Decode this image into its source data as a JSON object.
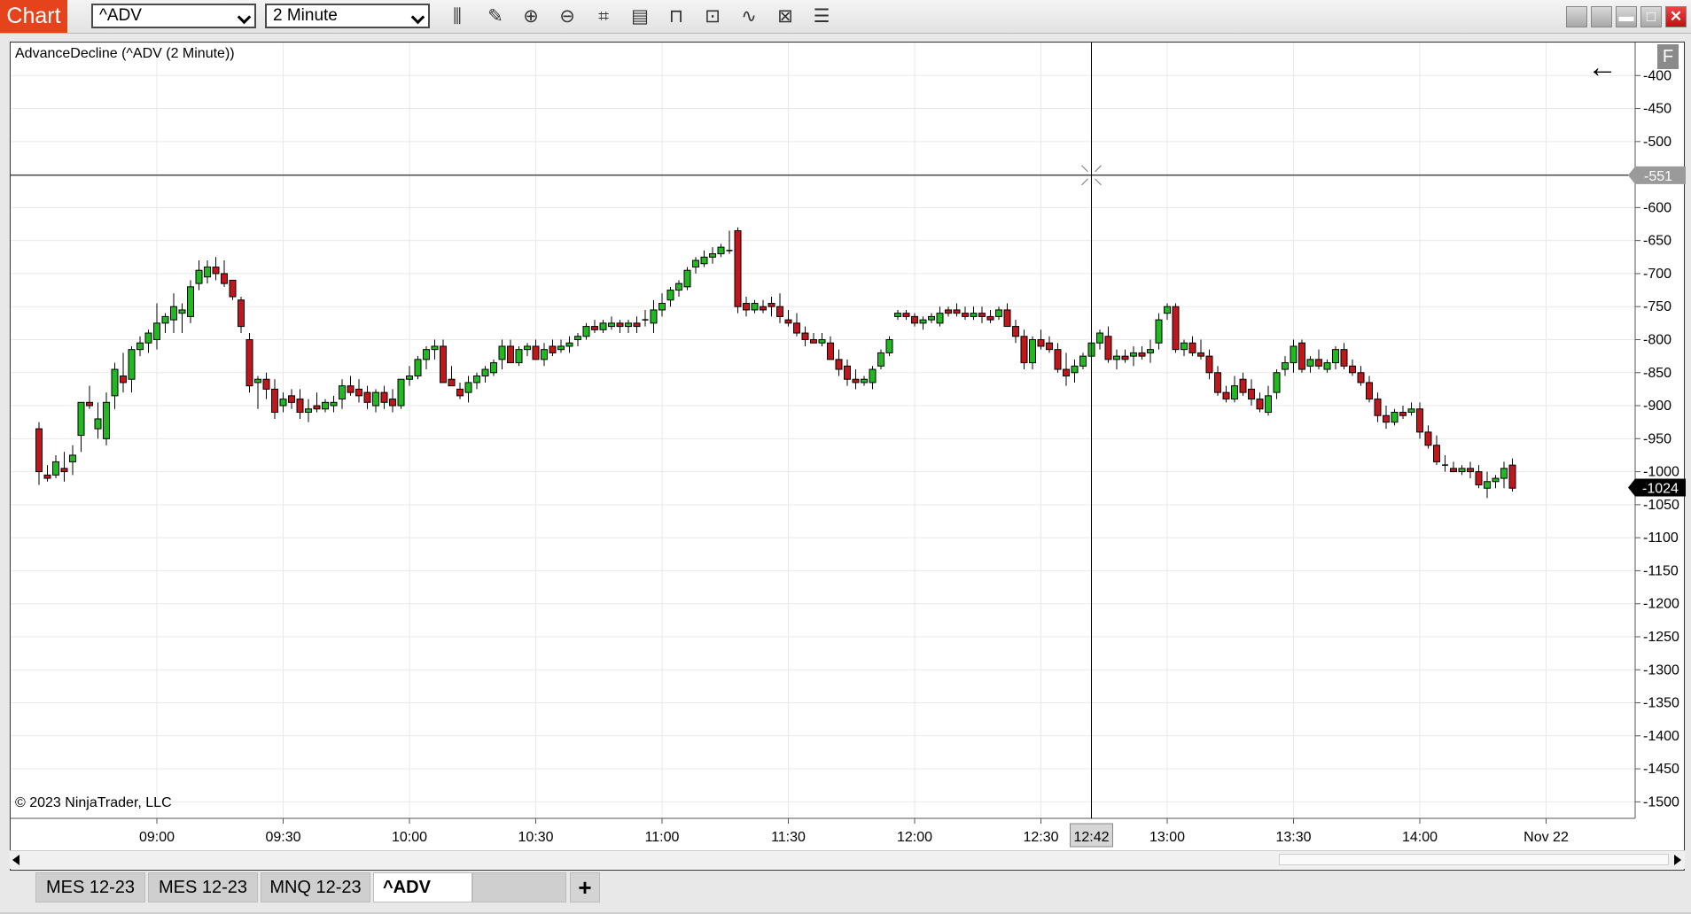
{
  "toolbar": {
    "chart_tab": "Chart",
    "instrument": "^ADV",
    "interval": "2 Minute",
    "tools": [
      {
        "name": "bars-type-icon",
        "glyph": "⫼"
      },
      {
        "name": "drawing-tool-icon",
        "glyph": "✎"
      },
      {
        "name": "zoom-in-icon",
        "glyph": "⊕"
      },
      {
        "name": "zoom-out-icon",
        "glyph": "⊖"
      },
      {
        "name": "crosshair-icon",
        "glyph": "⌗"
      },
      {
        "name": "data-box-icon",
        "glyph": "▤"
      },
      {
        "name": "strategies-icon",
        "glyph": "⊓"
      },
      {
        "name": "properties-icon",
        "glyph": "⊡"
      },
      {
        "name": "indicators-icon",
        "glyph": "∿"
      },
      {
        "name": "chart-trader-icon",
        "glyph": "⊠"
      },
      {
        "name": "show-list-icon",
        "glyph": "☰"
      }
    ],
    "window_buttons": [
      {
        "name": "window-option-button",
        "glyph": ""
      },
      {
        "name": "window-option-button-2",
        "glyph": ""
      },
      {
        "name": "minimize-button",
        "glyph": "▬"
      },
      {
        "name": "maximize-button",
        "glyph": "□"
      },
      {
        "name": "close-button",
        "glyph": "✕"
      }
    ]
  },
  "chart": {
    "indicator_label": "AdvanceDecline (^ADV (2 Minute))",
    "copyright": "© 2023 NinjaTrader, LLC",
    "back_icon": "←",
    "f_button": "F",
    "crosshair_price_label": "-551",
    "crosshair_time_label": "12:42",
    "last_price_label": "-1024",
    "colors": {
      "up": "#22b822",
      "down": "#c0161c",
      "grid": "#e9e9e9",
      "crosshair": "#000000"
    }
  },
  "chart_data": {
    "type": "candlestick",
    "x_ticks": [
      "09:00",
      "09:30",
      "10:00",
      "10:30",
      "11:00",
      "11:30",
      "12:00",
      "12:30",
      "13:00",
      "13:30",
      "14:00",
      "Nov 22"
    ],
    "y_ticks": [
      -400,
      -450,
      -500,
      -600,
      -650,
      -700,
      -750,
      -800,
      -850,
      -900,
      -950,
      -1000,
      -1050,
      -1100,
      -1150,
      -1200,
      -1250,
      -1300,
      -1350,
      -1400,
      -1450,
      -1500
    ],
    "ylim": [
      -1525,
      -350
    ],
    "first_bar_time": "08:32",
    "bar_minutes": 2,
    "ohlc": [
      [
        -935,
        -925,
        -1020,
        -1000
      ],
      [
        -1005,
        -990,
        -1015,
        -1010
      ],
      [
        -1005,
        -975,
        -1010,
        -985
      ],
      [
        -995,
        -970,
        -1015,
        -1000
      ],
      [
        -985,
        -960,
        -1005,
        -975
      ],
      [
        -945,
        -895,
        -970,
        -895
      ],
      [
        -895,
        -870,
        -905,
        -900
      ],
      [
        -935,
        -895,
        -950,
        -920
      ],
      [
        -950,
        -880,
        -960,
        -895
      ],
      [
        -885,
        -835,
        -905,
        -845
      ],
      [
        -855,
        -820,
        -880,
        -865
      ],
      [
        -860,
        -810,
        -880,
        -815
      ],
      [
        -815,
        -795,
        -825,
        -805
      ],
      [
        -805,
        -785,
        -820,
        -790
      ],
      [
        -800,
        -745,
        -815,
        -775
      ],
      [
        -775,
        -760,
        -790,
        -765
      ],
      [
        -770,
        -730,
        -790,
        -750
      ],
      [
        -760,
        -745,
        -790,
        -755
      ],
      [
        -765,
        -710,
        -775,
        -720
      ],
      [
        -715,
        -680,
        -725,
        -695
      ],
      [
        -705,
        -680,
        -715,
        -690
      ],
      [
        -690,
        -675,
        -710,
        -700
      ],
      [
        -700,
        -680,
        -720,
        -715
      ],
      [
        -710,
        -720,
        -740,
        -735
      ],
      [
        -740,
        -735,
        -790,
        -780
      ],
      [
        -800,
        -790,
        -880,
        -870
      ],
      [
        -865,
        -855,
        -905,
        -860
      ],
      [
        -860,
        -850,
        -890,
        -875
      ],
      [
        -875,
        -860,
        -920,
        -910
      ],
      [
        -900,
        -880,
        -910,
        -890
      ],
      [
        -885,
        -875,
        -905,
        -895
      ],
      [
        -890,
        -875,
        -920,
        -910
      ],
      [
        -910,
        -890,
        -925,
        -905
      ],
      [
        -900,
        -880,
        -910,
        -905
      ],
      [
        -905,
        -890,
        -910,
        -895
      ],
      [
        -900,
        -885,
        -910,
        -895
      ],
      [
        -890,
        -860,
        -905,
        -870
      ],
      [
        -870,
        -855,
        -885,
        -880
      ],
      [
        -875,
        -860,
        -895,
        -885
      ],
      [
        -880,
        -870,
        -905,
        -895
      ],
      [
        -900,
        -875,
        -910,
        -880
      ],
      [
        -880,
        -870,
        -905,
        -895
      ],
      [
        -890,
        -875,
        -910,
        -900
      ],
      [
        -900,
        -860,
        -905,
        -860
      ],
      [
        -860,
        -840,
        -870,
        -855
      ],
      [
        -855,
        -825,
        -860,
        -830
      ],
      [
        -830,
        -810,
        -845,
        -815
      ],
      [
        -815,
        -800,
        -830,
        -810
      ],
      [
        -810,
        -800,
        -865,
        -865
      ],
      [
        -860,
        -840,
        -870,
        -870
      ],
      [
        -875,
        -865,
        -890,
        -885
      ],
      [
        -880,
        -855,
        -895,
        -865
      ],
      [
        -865,
        -850,
        -875,
        -855
      ],
      [
        -855,
        -840,
        -865,
        -845
      ],
      [
        -850,
        -830,
        -855,
        -835
      ],
      [
        -830,
        -800,
        -845,
        -810
      ],
      [
        -810,
        -800,
        -835,
        -835
      ],
      [
        -835,
        -810,
        -840,
        -815
      ],
      [
        -815,
        -805,
        -825,
        -810
      ],
      [
        -810,
        -800,
        -830,
        -830
      ],
      [
        -830,
        -805,
        -840,
        -815
      ],
      [
        -810,
        -800,
        -825,
        -820
      ],
      [
        -815,
        -800,
        -820,
        -810
      ],
      [
        -810,
        -795,
        -820,
        -805
      ],
      [
        -800,
        -790,
        -810,
        -795
      ],
      [
        -795,
        -775,
        -800,
        -780
      ],
      [
        -780,
        -770,
        -790,
        -785
      ],
      [
        -785,
        -770,
        -790,
        -775
      ],
      [
        -780,
        -765,
        -785,
        -775
      ],
      [
        -775,
        -770,
        -790,
        -780
      ],
      [
        -780,
        -770,
        -790,
        -775
      ],
      [
        -775,
        -765,
        -790,
        -780
      ],
      [
        -770,
        -755,
        -780,
        -770
      ],
      [
        -775,
        -740,
        -790,
        -755
      ],
      [
        -755,
        -730,
        -765,
        -745
      ],
      [
        -740,
        -720,
        -750,
        -725
      ],
      [
        -725,
        -710,
        -735,
        -715
      ],
      [
        -720,
        -690,
        -725,
        -695
      ],
      [
        -690,
        -675,
        -700,
        -680
      ],
      [
        -685,
        -665,
        -690,
        -675
      ],
      [
        -675,
        -660,
        -685,
        -670
      ],
      [
        -670,
        -655,
        -675,
        -660
      ],
      [
        -665,
        -635,
        -670,
        -665
      ],
      [
        -635,
        -630,
        -760,
        -750
      ],
      [
        -745,
        -735,
        -765,
        -755
      ],
      [
        -755,
        -740,
        -760,
        -745
      ],
      [
        -750,
        -740,
        -760,
        -755
      ],
      [
        -745,
        -735,
        -765,
        -750
      ],
      [
        -750,
        -730,
        -775,
        -765
      ],
      [
        -770,
        -755,
        -780,
        -775
      ],
      [
        -775,
        -760,
        -795,
        -790
      ],
      [
        -790,
        -780,
        -810,
        -800
      ],
      [
        -800,
        -790,
        -805,
        -805
      ],
      [
        -805,
        -790,
        -810,
        -800
      ],
      [
        -805,
        -795,
        -830,
        -830
      ],
      [
        -830,
        -815,
        -855,
        -845
      ],
      [
        -840,
        -830,
        -870,
        -860
      ],
      [
        -860,
        -845,
        -875,
        -865
      ],
      [
        -865,
        -855,
        -870,
        -860
      ],
      [
        -865,
        -840,
        -875,
        -845
      ],
      [
        -840,
        -815,
        -845,
        -820
      ],
      [
        -820,
        -795,
        -825,
        -800
      ],
      [
        -765,
        -755,
        -770,
        -760
      ],
      [
        -760,
        -755,
        -770,
        -765
      ],
      [
        -765,
        -760,
        -780,
        -775
      ],
      [
        -775,
        -765,
        -785,
        -770
      ],
      [
        -770,
        -760,
        -775,
        -765
      ],
      [
        -775,
        -750,
        -780,
        -760
      ],
      [
        -755,
        -750,
        -765,
        -760
      ],
      [
        -755,
        -745,
        -765,
        -760
      ],
      [
        -760,
        -750,
        -770,
        -765
      ],
      [
        -765,
        -750,
        -770,
        -760
      ],
      [
        -760,
        -750,
        -775,
        -765
      ],
      [
        -765,
        -755,
        -775,
        -770
      ],
      [
        -765,
        -750,
        -770,
        -755
      ],
      [
        -755,
        -745,
        -780,
        -780
      ],
      [
        -780,
        -770,
        -805,
        -795
      ],
      [
        -795,
        -785,
        -845,
        -835
      ],
      [
        -835,
        -795,
        -845,
        -800
      ],
      [
        -800,
        -785,
        -815,
        -810
      ],
      [
        -805,
        -795,
        -820,
        -815
      ],
      [
        -815,
        -805,
        -850,
        -845
      ],
      [
        -845,
        -820,
        -870,
        -855
      ],
      [
        -850,
        -830,
        -865,
        -840
      ],
      [
        -840,
        -820,
        -845,
        -825
      ],
      [
        -825,
        -800,
        -835,
        -805
      ],
      [
        -805,
        -785,
        -815,
        -790
      ],
      [
        -795,
        -780,
        -835,
        -830
      ],
      [
        -830,
        -815,
        -845,
        -825
      ],
      [
        -825,
        -815,
        -835,
        -830
      ],
      [
        -825,
        -810,
        -840,
        -820
      ],
      [
        -820,
        -810,
        -830,
        -825
      ],
      [
        -820,
        -800,
        -835,
        -815
      ],
      [
        -805,
        -760,
        -815,
        -770
      ],
      [
        -760,
        -745,
        -770,
        -750
      ],
      [
        -750,
        -745,
        -820,
        -815
      ],
      [
        -815,
        -800,
        -825,
        -805
      ],
      [
        -805,
        -795,
        -825,
        -820
      ],
      [
        -820,
        -800,
        -830,
        -825
      ],
      [
        -825,
        -815,
        -860,
        -850
      ],
      [
        -850,
        -840,
        -885,
        -880
      ],
      [
        -880,
        -870,
        -895,
        -890
      ],
      [
        -890,
        -855,
        -895,
        -870
      ],
      [
        -860,
        -850,
        -885,
        -880
      ],
      [
        -875,
        -860,
        -900,
        -890
      ],
      [
        -890,
        -880,
        -910,
        -905
      ],
      [
        -910,
        -870,
        -915,
        -885
      ],
      [
        -880,
        -845,
        -890,
        -850
      ],
      [
        -845,
        -825,
        -855,
        -835
      ],
      [
        -835,
        -800,
        -850,
        -810
      ],
      [
        -805,
        -800,
        -850,
        -845
      ],
      [
        -840,
        -825,
        -850,
        -830
      ],
      [
        -830,
        -815,
        -845,
        -840
      ],
      [
        -845,
        -830,
        -850,
        -835
      ],
      [
        -835,
        -810,
        -845,
        -815
      ],
      [
        -815,
        -805,
        -845,
        -840
      ],
      [
        -840,
        -830,
        -855,
        -850
      ],
      [
        -850,
        -840,
        -870,
        -865
      ],
      [
        -865,
        -855,
        -895,
        -890
      ],
      [
        -890,
        -880,
        -925,
        -915
      ],
      [
        -915,
        -900,
        -935,
        -925
      ],
      [
        -925,
        -905,
        -930,
        -910
      ],
      [
        -910,
        -900,
        -920,
        -915
      ],
      [
        -910,
        -895,
        -915,
        -905
      ],
      [
        -905,
        -895,
        -950,
        -940
      ],
      [
        -940,
        -930,
        -965,
        -960
      ],
      [
        -960,
        -945,
        -990,
        -985
      ],
      [
        -990,
        -975,
        -1000,
        -990
      ],
      [
        -995,
        -985,
        -1000,
        -1000
      ],
      [
        -1000,
        -990,
        -1005,
        -995
      ],
      [
        -995,
        -985,
        -1010,
        -1000
      ],
      [
        -1000,
        -990,
        -1025,
        -1020
      ],
      [
        -1025,
        -1000,
        -1040,
        -1015
      ],
      [
        -1015,
        -1005,
        -1025,
        -1010
      ],
      [
        -1010,
        -985,
        -1025,
        -995
      ],
      [
        -990,
        -980,
        -1030,
        -1025
      ]
    ]
  },
  "tabs": [
    {
      "label": "MES 12-23",
      "active": false
    },
    {
      "label": "MES 12-23",
      "active": false
    },
    {
      "label": "MNQ 12-23",
      "active": false
    },
    {
      "label": "^ADV",
      "active": true
    }
  ],
  "add_tab": "+"
}
